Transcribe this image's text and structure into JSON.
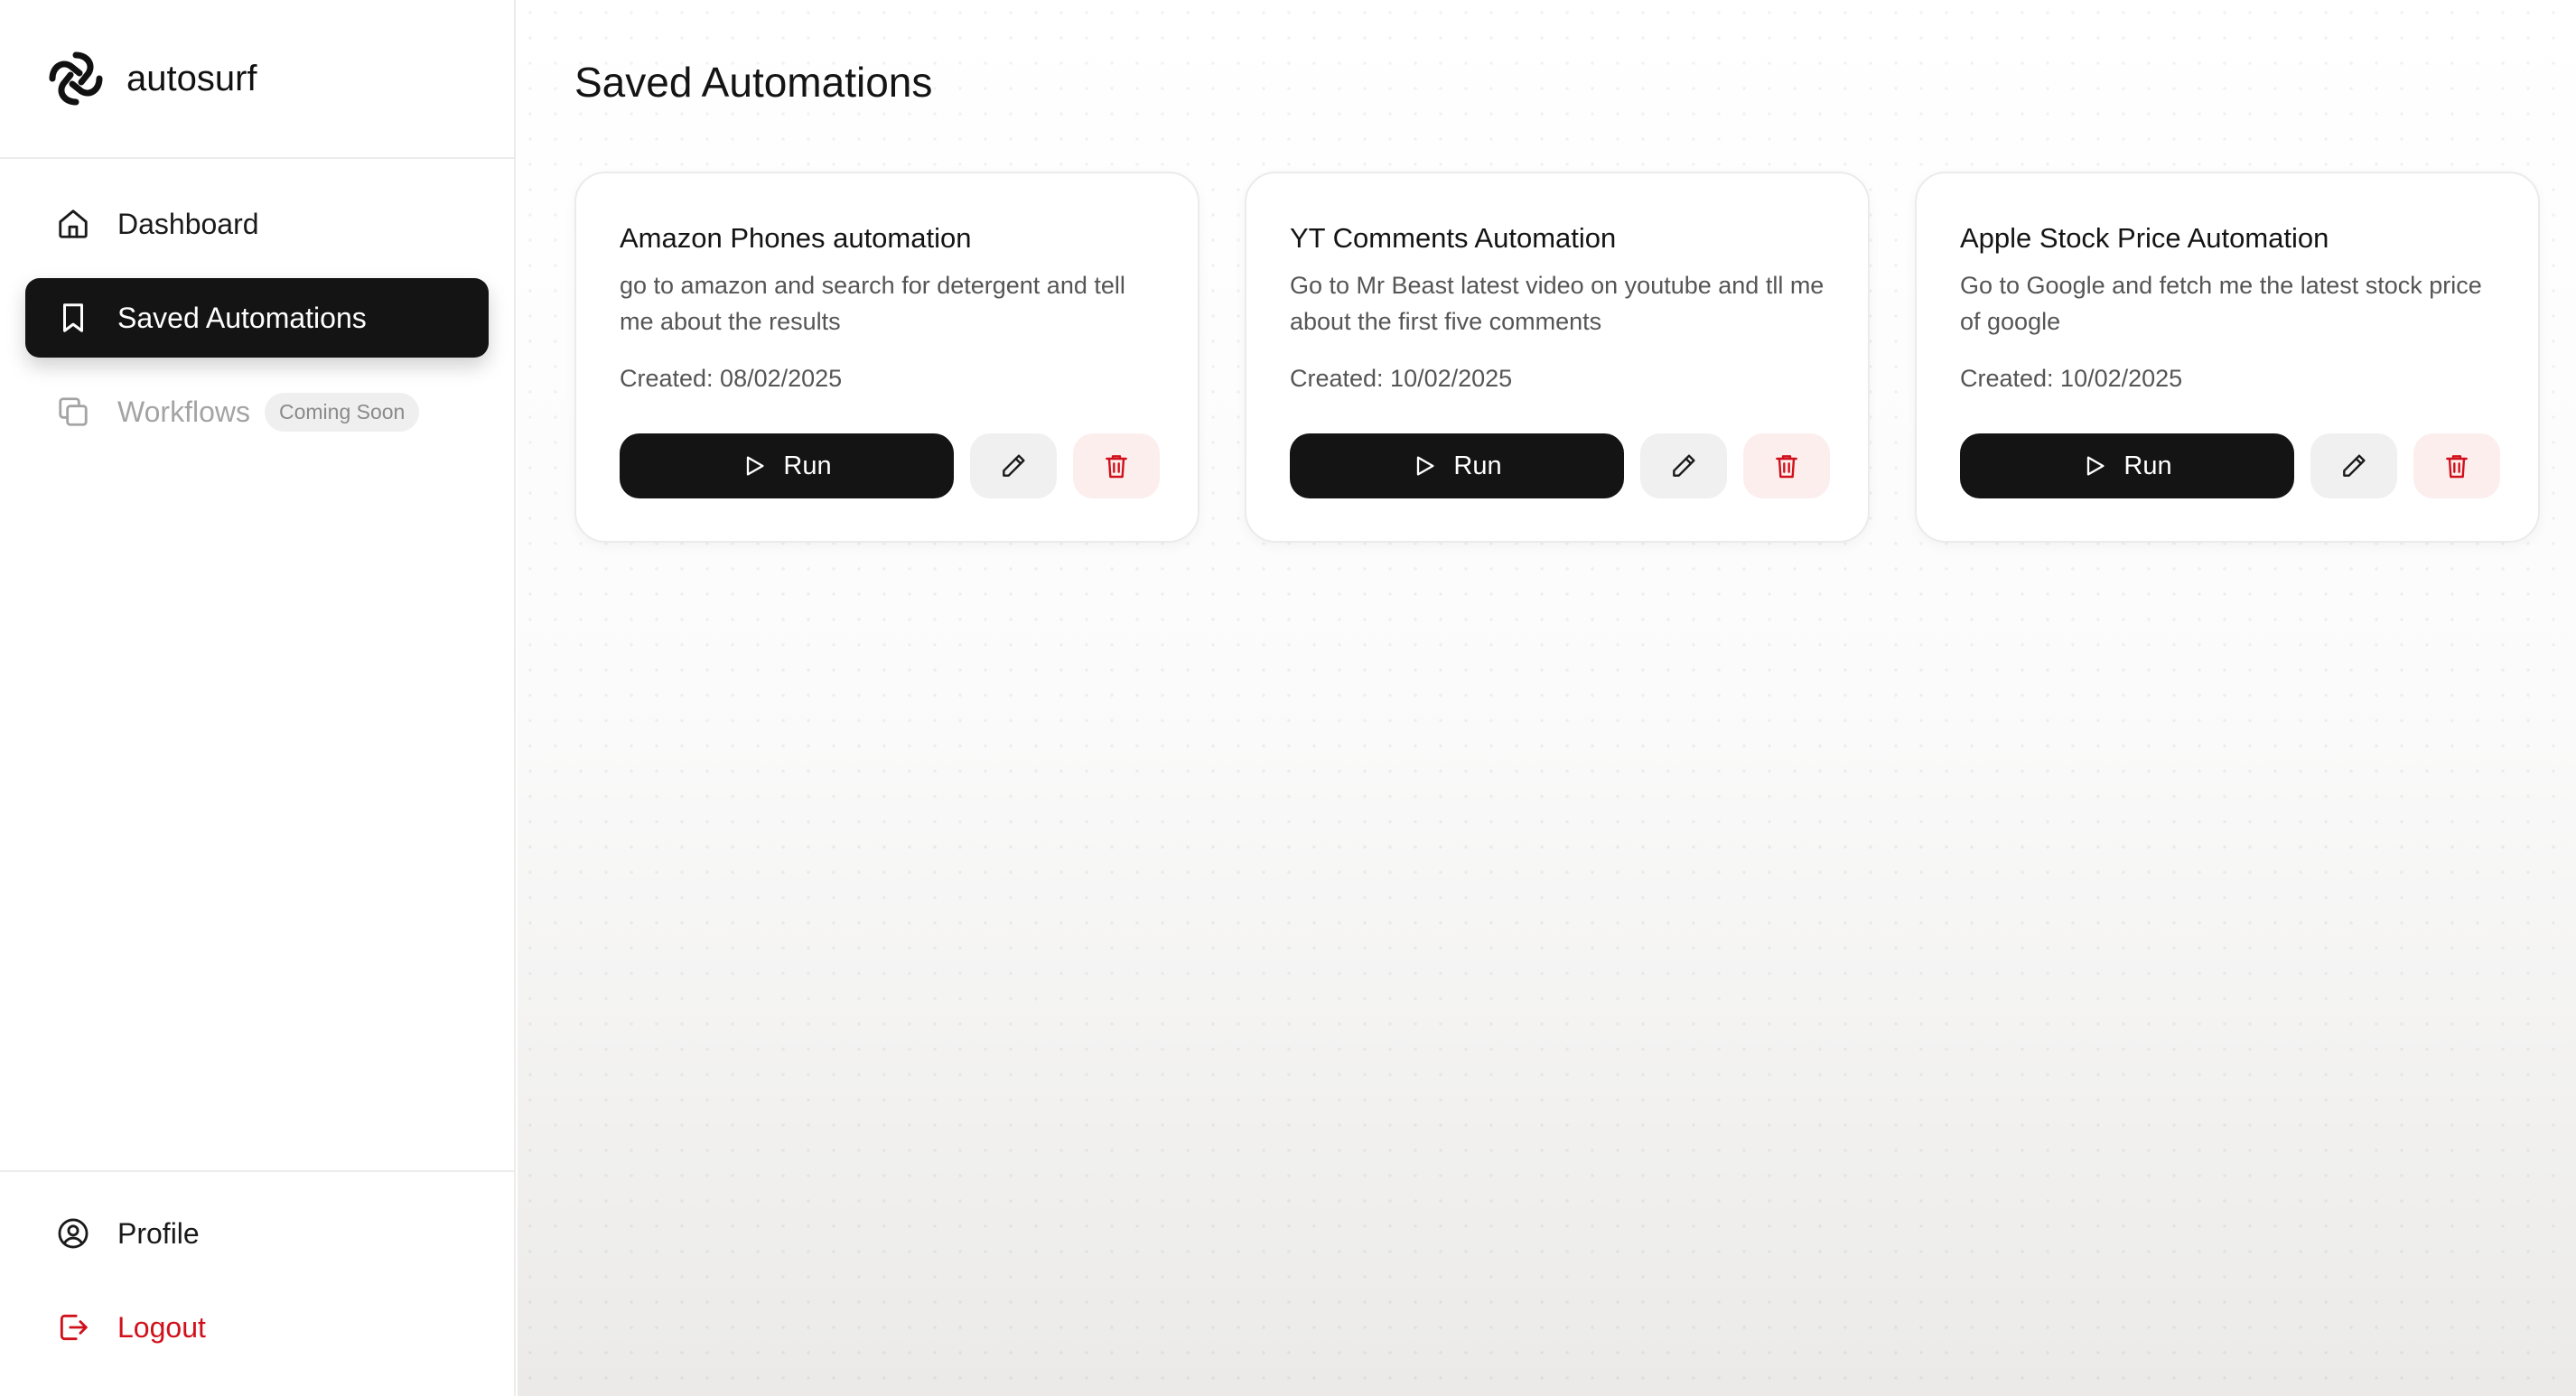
{
  "app": {
    "brand_name": "autosurf",
    "logo_icon": "autosurf-logo-icon"
  },
  "sidebar": {
    "items": [
      {
        "label": "Dashboard",
        "icon": "home-icon",
        "active": false
      },
      {
        "label": "Saved Automations",
        "icon": "bookmark-icon",
        "active": true
      },
      {
        "label": "Workflows",
        "icon": "copy-icon",
        "active": false,
        "disabled": true,
        "badge": "Coming Soon"
      }
    ],
    "bottom_items": [
      {
        "label": "Profile",
        "icon": "user-circle-icon"
      },
      {
        "label": "Logout",
        "icon": "logout-icon",
        "color": "#d0101b"
      }
    ]
  },
  "main": {
    "title": "Saved Automations",
    "cards": [
      {
        "title": "Amazon Phones automation",
        "description": "go to amazon and search for detergent and tell me about the results",
        "created": "Created: 08/02/2025",
        "run_label": "Run"
      },
      {
        "title": "YT Comments Automation",
        "description": "Go to Mr Beast latest video on youtube and tll me about the first five comments",
        "created": "Created: 10/02/2025",
        "run_label": "Run"
      },
      {
        "title": "Apple Stock Price Automation",
        "description": "Go to Google and fetch me the latest stock price of google",
        "created": "Created: 10/02/2025",
        "run_label": "Run"
      }
    ]
  },
  "colors": {
    "accent_dark": "#141414",
    "danger": "#d0101b",
    "danger_bg": "#fdeeee"
  }
}
